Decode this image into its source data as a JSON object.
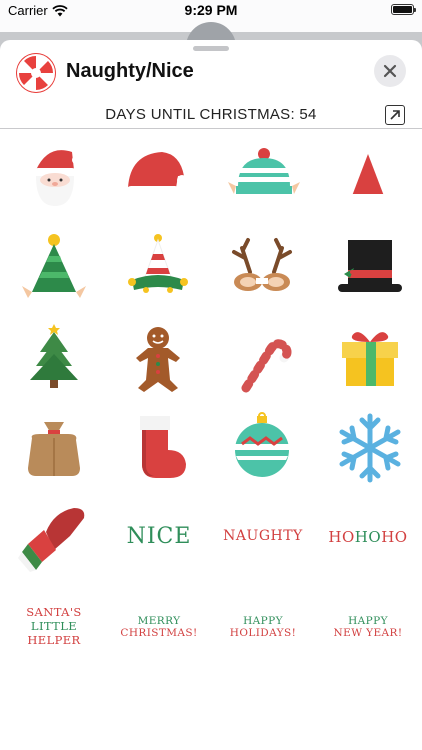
{
  "status": {
    "carrier": "Carrier",
    "time": "9:29 PM"
  },
  "header": {
    "title": "Naughty/Nice"
  },
  "countdown": {
    "text": "DAYS UNTIL CHRISTMAS: 54"
  },
  "stickers": {
    "nice": "NICE",
    "naughty": "NAUGHTY",
    "hohoho": [
      "HO",
      "HO",
      "HO"
    ],
    "santas_helper": [
      "SANTA'S",
      "LITTLE",
      "HELPER"
    ],
    "merry_christmas": [
      "MERRY",
      "CHRISTMAS!"
    ],
    "happy_holidays": [
      "HAPPY",
      "HOLIDAYS!"
    ],
    "happy_new_year": [
      "HAPPY",
      "NEW YEAR!"
    ]
  },
  "colors": {
    "red": "#d24040",
    "green": "#2f8e5a",
    "teal": "#4cc3a8"
  }
}
